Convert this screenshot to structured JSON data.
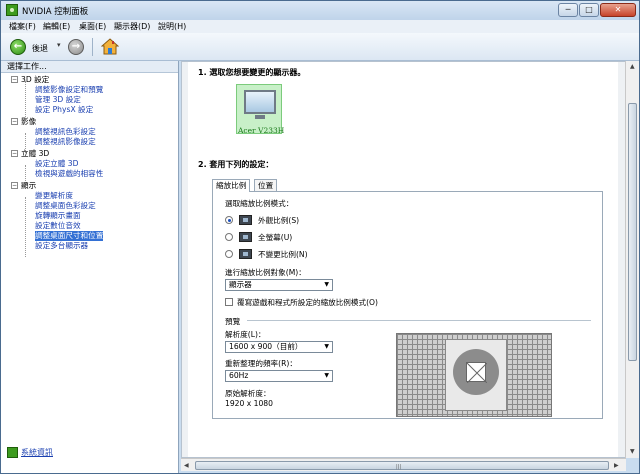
{
  "window": {
    "title": "NVIDIA 控制面板",
    "min": "─",
    "max": "□",
    "close": "✕"
  },
  "menu": [
    "檔案(F)",
    "編輯(E)",
    "桌面(E)",
    "顯示器(D)",
    "說明(H)"
  ],
  "toolbar": {
    "back_label": "後退",
    "back_icon": "←",
    "forward_icon": "→",
    "dropdown": "▾"
  },
  "left": {
    "header": "選擇工作...",
    "tree": [
      {
        "label": "3D 設定",
        "type": "cat",
        "expander": "−"
      },
      {
        "label": "調整影像設定和預覽",
        "type": "sub"
      },
      {
        "label": "管理 3D 設定",
        "type": "sub"
      },
      {
        "label": "設定 PhysX 設定",
        "type": "sub"
      },
      {
        "label": "影像",
        "type": "cat",
        "expander": "−"
      },
      {
        "label": "調整視訊色彩設定",
        "type": "sub"
      },
      {
        "label": "調整視訊影像設定",
        "type": "sub"
      },
      {
        "label": "立體 3D",
        "type": "cat",
        "expander": "−"
      },
      {
        "label": "設定立體 3D",
        "type": "sub"
      },
      {
        "label": "檢視與遊戲的相容性",
        "type": "sub"
      },
      {
        "label": "顯示",
        "type": "cat",
        "expander": "−"
      },
      {
        "label": "變更解析度",
        "type": "sub"
      },
      {
        "label": "調整桌面色彩設定",
        "type": "sub"
      },
      {
        "label": "旋轉顯示畫面",
        "type": "sub"
      },
      {
        "label": "設定數位音效",
        "type": "sub"
      },
      {
        "label": "調整桌面尺寸和位置",
        "type": "sub",
        "selected": true
      },
      {
        "label": "設定多台顯示器",
        "type": "sub"
      }
    ],
    "system_info": "系統資訊"
  },
  "main": {
    "section1": "1. 選取您想要變更的顯示器。",
    "monitor_name": "Acer V233H",
    "section2": "2. 套用下列的設定：",
    "tabs": [
      "縮放比例",
      "位置"
    ],
    "mode_label": "選取縮放比例模式：",
    "modes": [
      {
        "label": "外觀比例(S)",
        "checked": true
      },
      {
        "label": "全螢幕(U)",
        "checked": false
      },
      {
        "label": "不變更比例(N)",
        "checked": false
      }
    ],
    "perform_label": "進行縮放比例對象(M)：",
    "perform_value": "顯示器",
    "override_label": "覆寫遊戲和程式所設定的縮放比例模式(O)",
    "override_checked": false,
    "preview_label": "預覽",
    "resolution_label": "解析度(L)：",
    "resolution_value": "1600 x 900（目前）",
    "refresh_label": "重新整理的頻率(R)：",
    "refresh_value": "60Hz",
    "native_label": "原始解析度：",
    "native_value": "1920 x 1080"
  }
}
